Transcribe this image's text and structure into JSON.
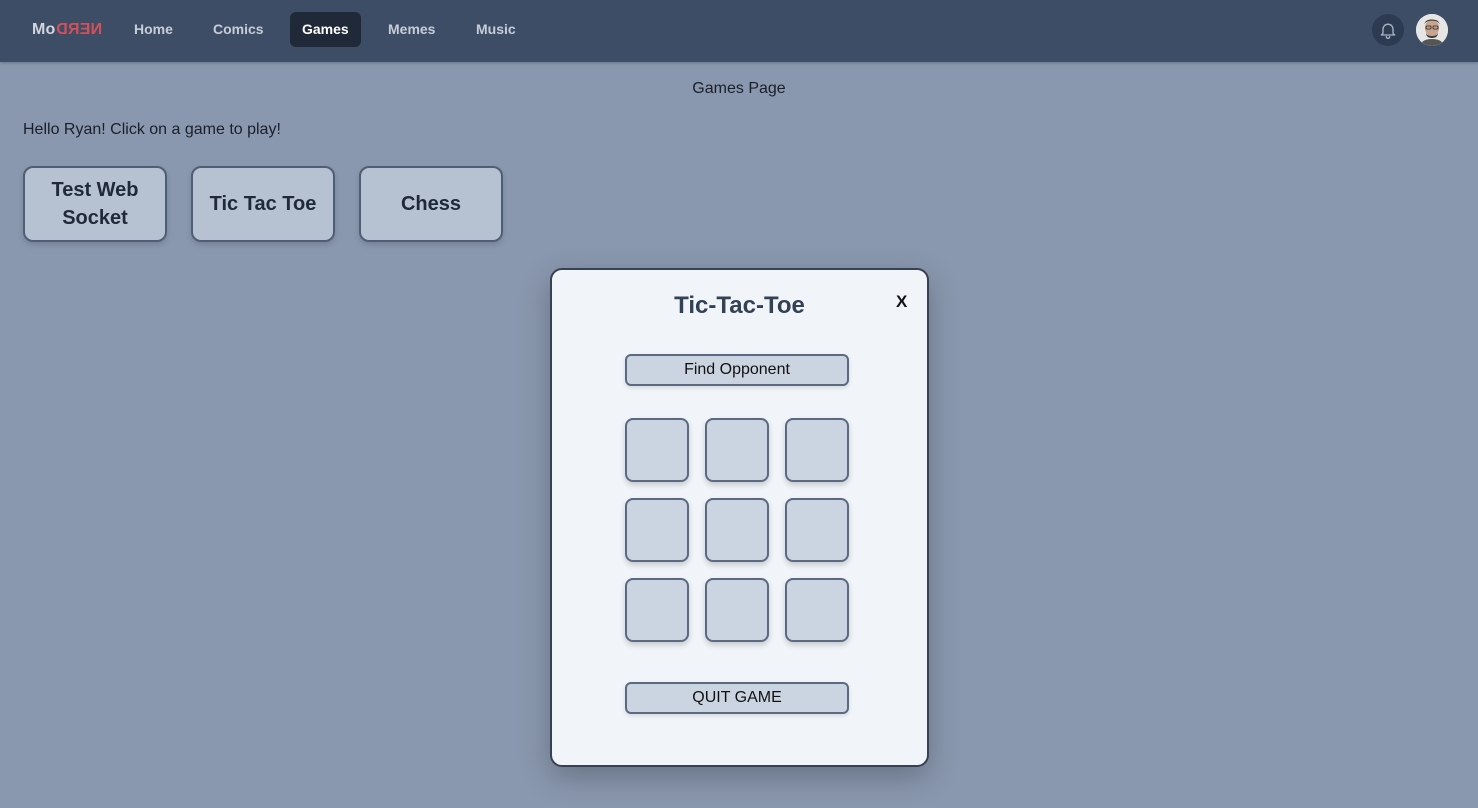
{
  "nav": {
    "logo_prefix": "Mo",
    "logo_accent": "NERD",
    "items": [
      {
        "label": "Home",
        "active": false
      },
      {
        "label": "Comics",
        "active": false
      },
      {
        "label": "Games",
        "active": true
      },
      {
        "label": "Memes",
        "active": false
      },
      {
        "label": "Music",
        "active": false
      }
    ],
    "icons": {
      "notifications": "bell-icon",
      "profile": "avatar"
    }
  },
  "page": {
    "title": "Games Page",
    "greeting": "Hello Ryan! Click on a game to play!"
  },
  "games": [
    {
      "label": "Test Web Socket"
    },
    {
      "label": "Tic Tac Toe"
    },
    {
      "label": "Chess"
    }
  ],
  "modal": {
    "title": "Tic-Tac-Toe",
    "close_label": "X",
    "find_opponent_label": "Find Opponent",
    "quit_label": "QUIT GAME",
    "board": [
      "",
      "",
      "",
      "",
      "",
      "",
      "",
      "",
      ""
    ]
  },
  "colors": {
    "background": "#8a98af",
    "navbar": "#3e4d66",
    "active_tab": "#1f2937",
    "logo_accent": "#d2505a",
    "card_bg": "#b6c2d2",
    "modal_bg": "#f1f5f9",
    "cell_bg": "#cbd5e1"
  }
}
